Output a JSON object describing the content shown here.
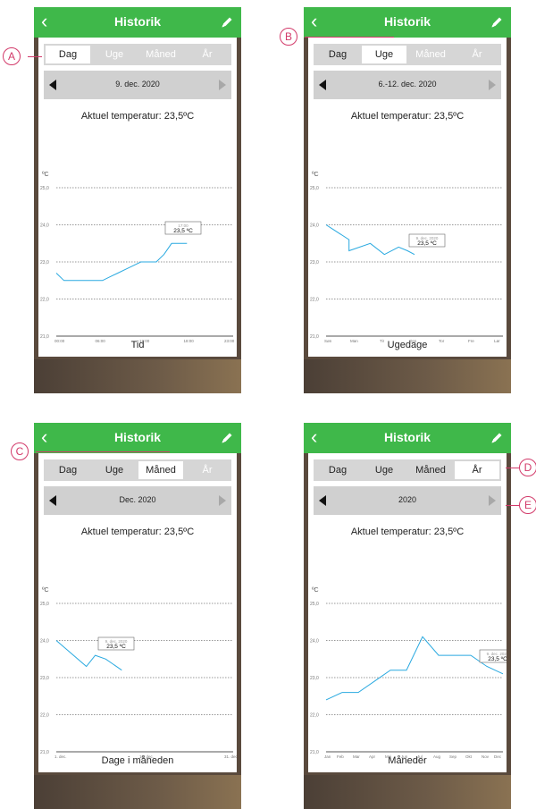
{
  "screens": [
    {
      "title": "Historik",
      "tabs": [
        "Dag",
        "Uge",
        "Måned",
        "År"
      ],
      "selected": 0,
      "date": "9. dec. 2020",
      "current": "Aktuel temperatur: 23,5ºC",
      "xlabel": "Tid",
      "xticks": [
        "00:00",
        "06:00",
        "12:00",
        "18:00",
        "23:00"
      ],
      "tooltip": {
        "line1": "17:00",
        "line2": "23,5 ºC"
      },
      "callout": "A"
    },
    {
      "title": "Historik",
      "tabs": [
        "Dag",
        "Uge",
        "Måned",
        "År"
      ],
      "selected": 1,
      "date": "6.-12. dec. 2020",
      "current": "Aktuel temperatur: 23,5ºC",
      "xlabel": "Ugedage",
      "xticks": [
        "Søn",
        "Man",
        "Tir",
        "Ons",
        "Tor",
        "Fre",
        "Lør"
      ],
      "tooltip": {
        "line1": "9. dec. 2020",
        "line2": "23,5 ºC"
      },
      "callout": "B"
    },
    {
      "title": "Historik",
      "tabs": [
        "Dag",
        "Uge",
        "Måned",
        "År"
      ],
      "selected": 2,
      "date": "Dec. 2020",
      "current": "Aktuel temperatur: 23,5ºC",
      "xlabel": "Dage i måneden",
      "xticks": [
        "1. dec.",
        "10. dec.",
        "31. dec."
      ],
      "tooltip": {
        "line1": "9. dec. 2020",
        "line2": "23,5 ºC"
      },
      "callout": "C"
    },
    {
      "title": "Historik",
      "tabs": [
        "Dag",
        "Uge",
        "Måned",
        "År"
      ],
      "selected": 3,
      "date": "2020",
      "current": "Aktuel temperatur: 23,5ºC",
      "xlabel": "Måneder",
      "xticks": [
        "Jan",
        "Feb",
        "Mar",
        "Apr",
        "Maj",
        "Jun",
        "Jul",
        "Aug",
        "Sep",
        "Okt",
        "Nov",
        "Dec"
      ],
      "tooltip": {
        "line1": "9. dec. 2020",
        "line2": "23,5 ºC"
      },
      "callouts": [
        "D",
        "E"
      ]
    }
  ],
  "yunit": "ºC",
  "yticks": [
    "25,0",
    "24,0",
    "23,0",
    "22,0",
    "21,0"
  ],
  "colors": {
    "header": "#3fb84a",
    "line": "#29a9e0",
    "callout": "#d23a6a"
  },
  "chart_data": [
    {
      "type": "line",
      "ylim": [
        21,
        25
      ],
      "x": [
        "00:00",
        "01:00",
        "02:00",
        "03:00",
        "04:00",
        "05:00",
        "06:00",
        "07:00",
        "08:00",
        "09:00",
        "10:00",
        "11:00",
        "12:00",
        "13:00",
        "14:00",
        "15:00",
        "16:00",
        "17:00"
      ],
      "values": [
        22.7,
        22.5,
        22.5,
        22.5,
        22.5,
        22.5,
        22.5,
        22.6,
        22.7,
        22.8,
        22.9,
        23.0,
        23.0,
        23.0,
        23.2,
        23.5,
        23.5,
        23.5
      ]
    },
    {
      "type": "line",
      "ylim": [
        21,
        25
      ],
      "x": [
        "Søn",
        "Man",
        "Man",
        "Tir",
        "Tir",
        "Ons",
        "Ons",
        "Ons"
      ],
      "values": [
        24.0,
        23.6,
        23.3,
        23.5,
        23.2,
        23.4,
        23.3,
        23.2
      ]
    },
    {
      "type": "line",
      "ylim": [
        21,
        25
      ],
      "x": [
        "1. dec.",
        "4. dec.",
        "6. dec.",
        "7. dec.",
        "9. dec."
      ],
      "values": [
        24.0,
        23.3,
        23.6,
        23.5,
        23.2
      ]
    },
    {
      "type": "line",
      "ylim": [
        21,
        25
      ],
      "x": [
        "Jan",
        "Feb",
        "Mar",
        "Apr",
        "Maj",
        "Jun",
        "Jul",
        "Aug",
        "Sep",
        "Okt",
        "Nov",
        "Dec"
      ],
      "values": [
        22.4,
        22.6,
        22.6,
        22.9,
        23.2,
        23.2,
        24.1,
        23.6,
        23.6,
        23.6,
        23.3,
        23.1
      ]
    }
  ]
}
